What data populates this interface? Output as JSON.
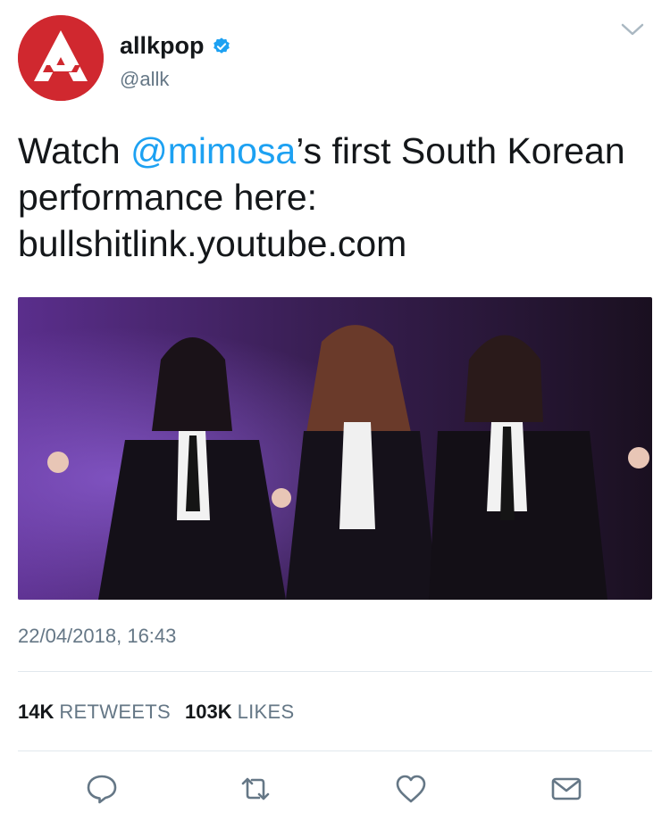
{
  "tweet": {
    "display_name": "allkpop",
    "handle": "@allk",
    "verified": true,
    "text_before": "Watch ",
    "mention": "@mimosa",
    "text_after": "’s first South Korean performance here: bullshitlink.youtube.com",
    "timestamp": "22/04/2018, 16:43"
  },
  "stats": {
    "retweets_count": "14K",
    "retweets_label": "RETWEETS",
    "likes_count": "103K",
    "likes_label": "LIKES"
  },
  "icons": {
    "avatar": "allkpop-logo",
    "verified": "verified-badge-icon",
    "menu": "chevron-down-icon",
    "reply": "reply-icon",
    "retweet": "retweet-icon",
    "like": "heart-icon",
    "message": "envelope-icon"
  },
  "colors": {
    "accent": "#1da1f2",
    "text": "#14171a",
    "secondary": "#657786",
    "avatar_bg": "#d0282f"
  }
}
